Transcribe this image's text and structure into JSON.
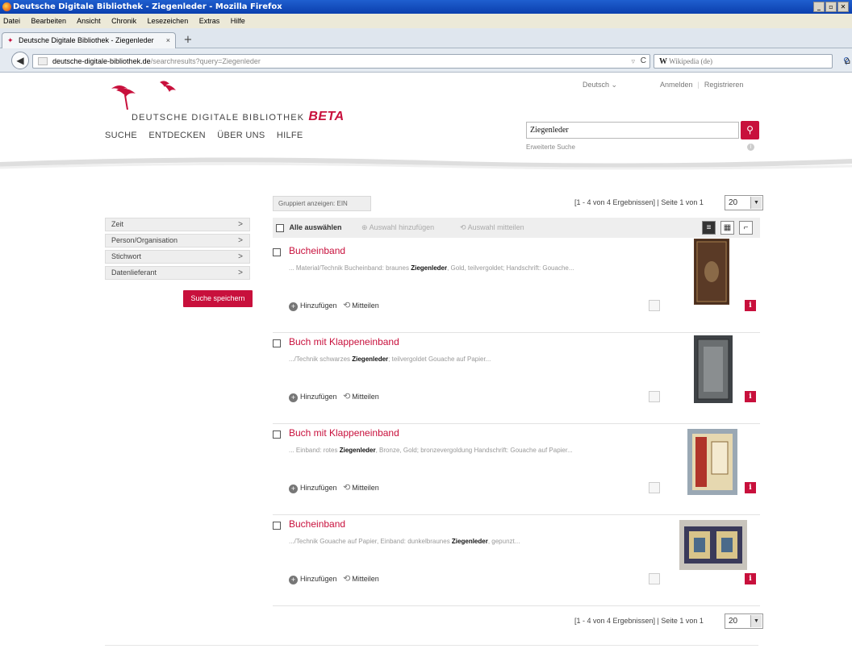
{
  "window": {
    "title": "Deutsche Digitale Bibliothek - Ziegenleder - Mozilla Firefox",
    "controls": [
      "_",
      "▫",
      "✕"
    ]
  },
  "menu": [
    "Datei",
    "Bearbeiten",
    "Ansicht",
    "Chronik",
    "Lesezeichen",
    "Extras",
    "Hilfe"
  ],
  "tab": {
    "title": "Deutsche Digitale Bibliothek - Ziegenleder",
    "close": "×",
    "new": "+"
  },
  "nav": {
    "url_domain": "deutsche-digitale-bibliothek.de",
    "url_path": "/searchresults?query=Ziegenleder",
    "search_engine": "W",
    "search_placeholder": "Wikipedia (de)"
  },
  "header": {
    "logo_text": "DEUTSCHE DIGITALE BIBLIOTHEK",
    "logo_beta": "BETA",
    "language": "Deutsch",
    "login": "Anmelden",
    "register": "Registrieren",
    "mainnav": [
      "SUCHE",
      "ENTDECKEN",
      "ÜBER UNS",
      "HILFE"
    ],
    "search_value": "Ziegenleder",
    "advanced_search": "Erweiterte Suche",
    "colors": {
      "accent": "#c8103c"
    }
  },
  "results_meta": {
    "group_button": "Gruppiert anzeigen: EIN",
    "pager_text": "[1 - 4 von 4 Ergebnissen] | Seite 1 von 1",
    "per_page": "20",
    "select_all": "Alle auswählen",
    "add_selection": "Auswahl hinzufügen",
    "share_selection": "Auswahl mitteilen"
  },
  "facets": [
    "Zeit",
    "Person/Organisation",
    "Stichwort",
    "Datenlieferant"
  ],
  "save_search": "Suche speichern",
  "result_actions": {
    "add": "Hinzufügen",
    "share": "Mitteilen"
  },
  "results": [
    {
      "title": "Bucheinband",
      "snippet_pre": "... Material/Technik Bucheinband: braunes ",
      "snippet_hl": "Ziegenleder",
      "snippet_post": ", Gold, teilvergoldet; Handschrift: Gouache..."
    },
    {
      "title": "Buch mit Klappeneinband",
      "snippet_pre": ".../Technik schwarzes ",
      "snippet_hl": "Ziegenleder",
      "snippet_post": "; teilvergoldet Gouache auf Papier..."
    },
    {
      "title": "Buch mit Klappeneinband",
      "snippet_pre": "... Einband: rotes ",
      "snippet_hl": "Ziegenleder",
      "snippet_post": ", Bronze, Gold; bronzevergoldung Handschrift: Gouache auf Papier..."
    },
    {
      "title": "Bucheinband",
      "snippet_pre": ".../Technik Gouache auf Papier, Einband: dunkelbraunes ",
      "snippet_hl": "Ziegenleder",
      "snippet_post": ", gepunzt..."
    }
  ]
}
